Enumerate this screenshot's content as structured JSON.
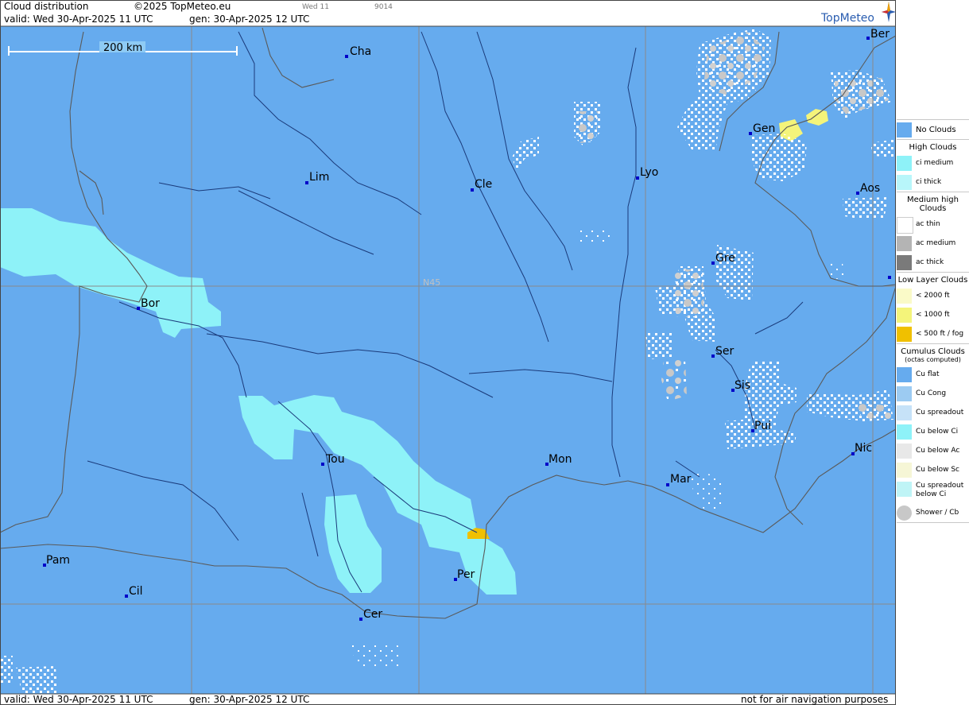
{
  "header": {
    "title": "Cloud distribution",
    "copyright": "©2025 TopMeteo.eu",
    "slot": "Wed 11",
    "code": "9014",
    "valid": "valid:  Wed  30-Apr-2025  11 UTC",
    "gen": "gen: 30-Apr-2025 12 UTC"
  },
  "footer": {
    "valid": "valid:  Wed  30-Apr-2025  11 UTC",
    "gen": "gen: 30-Apr-2025 12 UTC",
    "disclaimer": "not for air navigation purposes"
  },
  "logo": {
    "text": "TopMeteo",
    "icon": "compass-star-icon"
  },
  "map": {
    "scale_label": "200 km",
    "lat_label": "N45",
    "colors": {
      "sea": "#66abee",
      "ci": "#8ef2f8",
      "fog": "#f0c000",
      "thin_yellow": "#f4f47a",
      "border": "#6e6e6e",
      "river": "#1a3a7a",
      "grid": "#8a8a8a"
    },
    "cities": [
      {
        "name": "Cha"
      },
      {
        "name": "Ber"
      },
      {
        "name": "Gen"
      },
      {
        "name": "Lim"
      },
      {
        "name": "Cle"
      },
      {
        "name": "Lyo"
      },
      {
        "name": "Aos"
      },
      {
        "name": "Gre"
      },
      {
        "name": "Bor"
      },
      {
        "name": "Ser"
      },
      {
        "name": "Sis"
      },
      {
        "name": "Pui"
      },
      {
        "name": "Tou"
      },
      {
        "name": "Mon"
      },
      {
        "name": "Nic"
      },
      {
        "name": "Mar"
      },
      {
        "name": "Pam"
      },
      {
        "name": "Per"
      },
      {
        "name": "Cil"
      },
      {
        "name": "Cer"
      }
    ]
  },
  "legend": {
    "no_clouds": "No Clouds",
    "high_clouds": "High Clouds",
    "ci_medium": "ci medium",
    "ci_thick": "ci thick",
    "medium_high": "Medium high Clouds",
    "ac_thin": "ac thin",
    "ac_medium": "ac medium",
    "ac_thick": "ac thick",
    "low_layer": "Low Layer Clouds",
    "lt2000": "< 2000 ft",
    "lt1000": "< 1000 ft",
    "lt500": "< 500 ft / fog",
    "cumulus": "Cumulus Clouds",
    "cumulus_sub": "(octas computed)",
    "cu_flat": "Cu flat",
    "cu_cong": "Cu Cong",
    "cu_spreadout": "Cu spreadout",
    "cu_below_ci": "Cu below Ci",
    "cu_below_ac": "Cu below Ac",
    "cu_below_sc": "Cu below Sc",
    "cu_spread_below_ci": "Cu spreadout below Ci",
    "shower": "Shower / Cb"
  }
}
